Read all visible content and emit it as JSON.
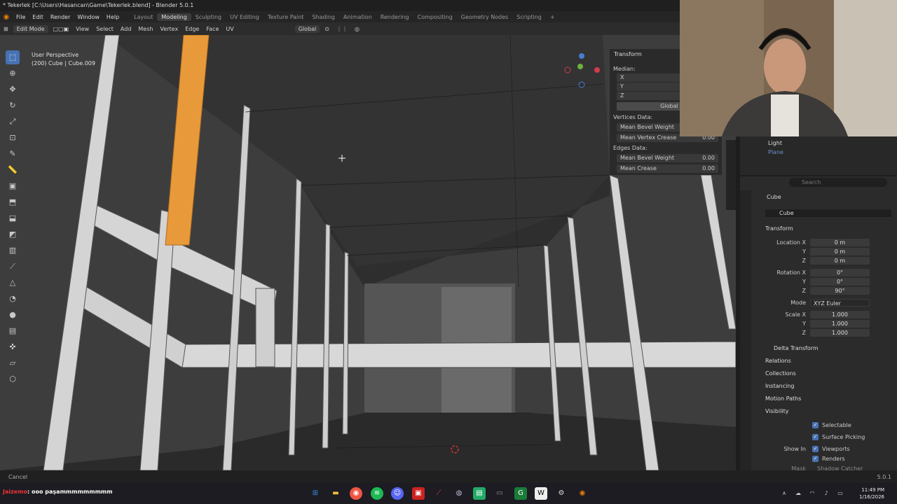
{
  "window": {
    "title": "* Tekerlek [C:\\Users\\Hasancan\\Game\\Tekerlek.blend] - Blender 5.0.1"
  },
  "menubar": {
    "menus": [
      "File",
      "Edit",
      "Render",
      "Window",
      "Help"
    ],
    "workspaces": [
      "Layout",
      "Modeling",
      "Sculpting",
      "UV Editing",
      "Texture Paint",
      "Shading",
      "Animation",
      "Rendering",
      "Compositing",
      "Geometry Nodes",
      "Scripting"
    ],
    "active_workspace": "Modeling"
  },
  "header": {
    "mode": "Edit Mode",
    "menus": [
      "View",
      "Select",
      "Add",
      "Mesh",
      "Vertex",
      "Edge",
      "Face",
      "UV"
    ],
    "orientation": "Global"
  },
  "viewport": {
    "view_name": "User Perspective",
    "object_info": "(200) Cube | Cube.009"
  },
  "npanel": {
    "title": "Transform",
    "median_label": "Median:",
    "axes": [
      "X",
      "Y",
      "Z"
    ],
    "space_button": "Global",
    "vertices_data": "Vertices Data:",
    "mean_bevel_weight": "Mean Bevel Weight",
    "mean_vertex_crease": "Mean Vertex Crease",
    "mean_vertex_crease_value": "0.00",
    "edges_data": "Edges Data:",
    "edge_bevel_weight_value": "0.00",
    "mean_crease": "Mean Crease",
    "mean_crease_value": "0.00"
  },
  "outliner": {
    "items": [
      "Light",
      "Plane"
    ]
  },
  "properties": {
    "search_placeholder": "Search",
    "object_name": "Cube",
    "data_name": "Cube",
    "transform_section": "Transform",
    "location_label": "Location X",
    "location": [
      "0 m",
      "0 m",
      "0 m"
    ],
    "rotation_label": "Rotation X",
    "rotation": [
      "0°",
      "0°",
      "90°"
    ],
    "mode_label": "Mode",
    "mode_value": "XYZ Euler",
    "scale_label": "Scale X",
    "scale": [
      "1.000",
      "1.000",
      "1.000"
    ],
    "y_label": "Y",
    "z_label": "Z",
    "sections": [
      "Delta Transform",
      "Relations",
      "Collections",
      "Instancing",
      "Motion Paths",
      "Visibility"
    ],
    "selectable": "Selectable",
    "surface_picking": "Surface Picking",
    "show_in": "Show In",
    "viewports": "Viewports",
    "renders": "Renders",
    "mask": "Mask",
    "shadow_catcher": "Shadow Catcher"
  },
  "statusbar": {
    "left": "Cancel",
    "version": "5.0.1"
  },
  "taskbar": {
    "chat_user": "Jaizemo",
    "chat_message": ": ooo paşammmmmmmmm",
    "time": "11:49 PM",
    "date": "1/16/2026"
  },
  "colors": {
    "accent": "#4772b3",
    "selection": "#e89a3a",
    "blender_orange": "#e87d0d"
  }
}
